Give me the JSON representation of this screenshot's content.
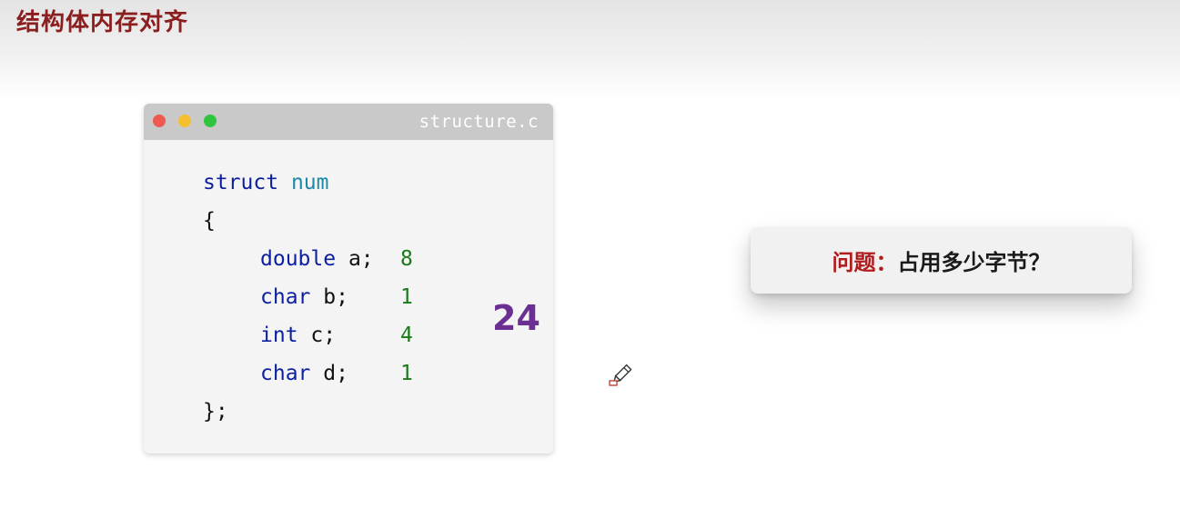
{
  "slide": {
    "title": "结构体内存对齐"
  },
  "code_window": {
    "filename": "structure.c",
    "lines": {
      "l1_kw": "struct",
      "l1_name": "num",
      "l2": "{",
      "l3_kw": "double",
      "l3_rest": " a;",
      "l3_size": "8",
      "l4_kw": "char",
      "l4_rest": " b;",
      "l4_size": "1",
      "l5_kw": "int",
      "l5_rest": " c;",
      "l5_size": "4",
      "l6_kw": "char",
      "l6_rest": " d;",
      "l6_size": "1",
      "l7": "};"
    },
    "total_size": "24"
  },
  "question": {
    "label": "问题：",
    "text": "占用多少字节？"
  },
  "colors": {
    "title": "#8b1f1f",
    "keyword": "#0b1fa0",
    "identifier": "#1a8aa8",
    "size_number": "#1a7a1a",
    "total": "#6b2f92",
    "question_label": "#b01b1b"
  },
  "icons": {
    "cursor": "pen-cursor-icon",
    "window_controls": [
      "close-dot-icon",
      "minimize-dot-icon",
      "maximize-dot-icon"
    ]
  }
}
